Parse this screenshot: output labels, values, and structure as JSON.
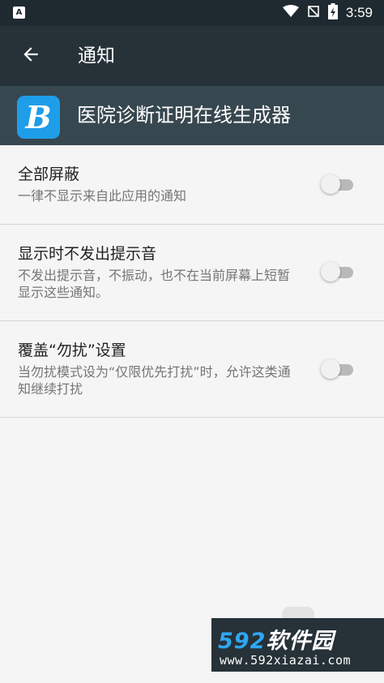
{
  "status_bar": {
    "left_icon": "A",
    "time": "3:59",
    "icons": [
      "wifi-icon",
      "no-signal-icon",
      "battery-charging-icon"
    ]
  },
  "toolbar": {
    "back_icon": "arrow-left-icon",
    "title": "通知"
  },
  "app": {
    "icon_letter": "B",
    "name": "医院诊断证明在线生成器"
  },
  "settings": [
    {
      "title": "全部屏蔽",
      "summary": "一律不显示来自此应用的通知",
      "enabled": false
    },
    {
      "title": "显示时不发出提示音",
      "summary": "不发出提示音，不振动，也不在当前屏幕上短暂显示这些通知。",
      "enabled": false
    },
    {
      "title": "覆盖“勿扰”设置",
      "summary": "当勿扰模式设为“仅限优先打扰”时，允许这类通知继续打扰",
      "enabled": false
    }
  ],
  "watermark": {
    "number": "592",
    "brand": "软件园",
    "url": "www.592xiazai.com"
  },
  "colors": {
    "status_bar": "#1f2a30",
    "toolbar": "#263238",
    "app_header": "#37474f",
    "app_icon": "#1e9de9",
    "background": "#f5f5f5",
    "toggle_off_track": "#b9b9b9",
    "toggle_off_thumb": "#f1f1f1"
  }
}
